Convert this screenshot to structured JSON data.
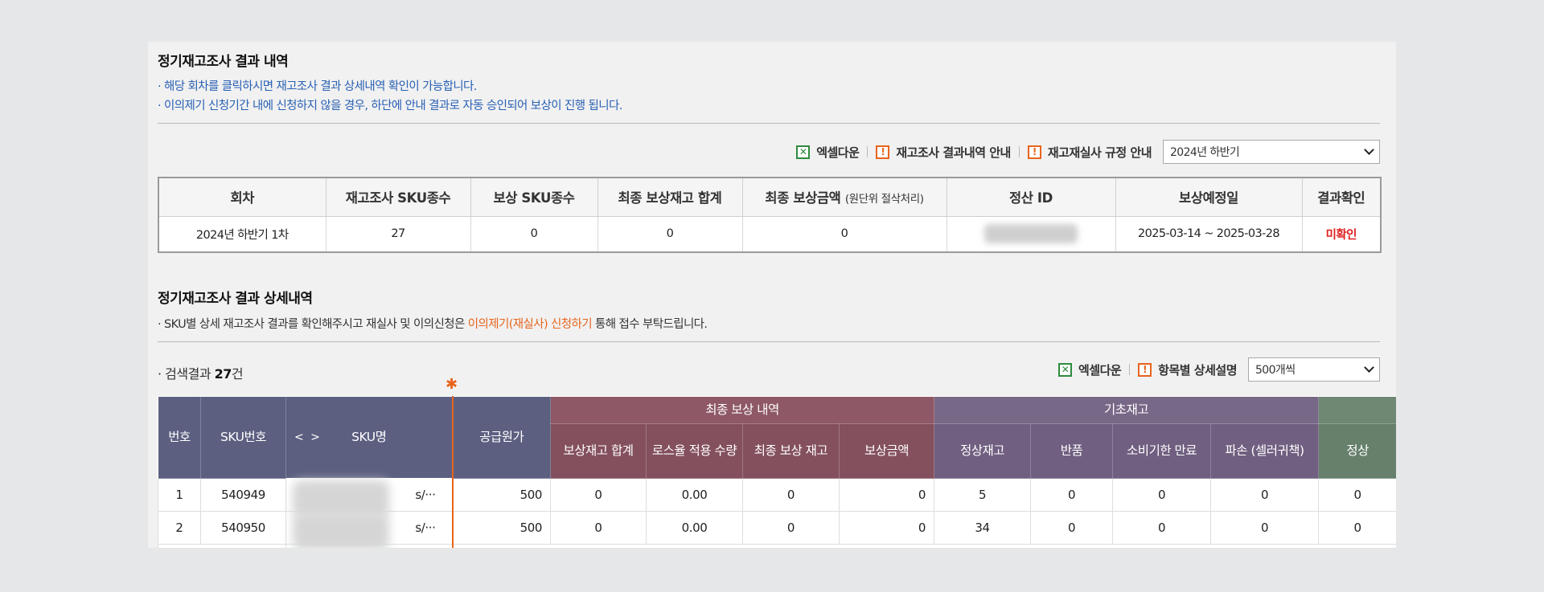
{
  "section1": {
    "title": "정기재고조사 결과 내역",
    "notice1": "· 해당 회차를 클릭하시면 재고조사 결과 상세내역 확인이 가능합니다.",
    "notice2": "· 이의제기 신청기간 내에 신청하지 않을 경우, 하단에 안내 결과로 자동 승인되어 보상이 진행 됩니다."
  },
  "toolbar1": {
    "excel_label": "엑셀다운",
    "guide1_label": "재고조사 결과내역 안내",
    "guide2_label": "재고재실사 규정 안내",
    "period_select": "2024년 하반기"
  },
  "summary": {
    "headers": [
      "회차",
      "재고조사 SKU종수",
      "보상 SKU종수",
      "최종 보상재고 합계",
      "최종 보상금액",
      "(원단위 절삭처리)",
      "정산 ID",
      "보상예정일",
      "결과확인"
    ],
    "row": {
      "round": "2024년 하반기 1차",
      "sku_count": "27",
      "comp_sku_count": "0",
      "final_stock_total": "0",
      "final_amount": "0",
      "settlement_id": "",
      "schedule": "2025-03-14 ~ 2025-03-28",
      "result": "미확인"
    }
  },
  "section2": {
    "title": "정기재고조사 결과 상세내역",
    "notice_prefix": "· SKU별 상세 재고조사 결과를 확인해주시고 재실사 및 이의신청은 ",
    "notice_link": "이의제기(재실사) 신청하기",
    "notice_suffix": " 통해 접수 부탁드립니다."
  },
  "results": {
    "prefix": "· 검색결과 ",
    "count": "27",
    "suffix": "건"
  },
  "toolbar2": {
    "excel_label": "엑셀다운",
    "detail_label": "항목별 상세설명",
    "page_size_select": "500개씩"
  },
  "grid": {
    "headers": {
      "no": "번호",
      "sku_no": "SKU번호",
      "sort_arrows": "< >",
      "sku_name": "SKU명",
      "supply_price": "공급원가",
      "group_final": "최종 보상 내역",
      "group_base": "기초재고",
      "comp_stock_total": "보상재고 합계",
      "loss_applied": "로스율 적용 수량",
      "final_comp_stock": "최종 보상 재고",
      "comp_amount": "보상금액",
      "normal_stock": "정상재고",
      "returned": "반품",
      "expired": "소비기한 만료",
      "damaged": "파손 (셀러귀책)",
      "normal": "정상"
    },
    "rows": [
      {
        "no": "1",
        "sku": "540949",
        "name_suffix": "s/···",
        "price": "500",
        "comp_total": "0",
        "loss": "0.00",
        "final": "0",
        "amount": "0",
        "normal_stock": "5",
        "returned": "0",
        "expired": "0",
        "damaged": "0",
        "normal": "0"
      },
      {
        "no": "2",
        "sku": "540950",
        "name_suffix": "s/···",
        "price": "500",
        "comp_total": "0",
        "loss": "0.00",
        "final": "0",
        "amount": "0",
        "normal_stock": "34",
        "returned": "0",
        "expired": "0",
        "damaged": "0",
        "normal": "0"
      }
    ]
  },
  "colors": {
    "blue_notice": "#2860b4",
    "orange_accent": "#e8641c",
    "red_status": "#e02020",
    "header_navy": "#5c5f80",
    "header_maroon": "#84505e",
    "header_purple": "#705f80",
    "header_green": "#66806b"
  }
}
